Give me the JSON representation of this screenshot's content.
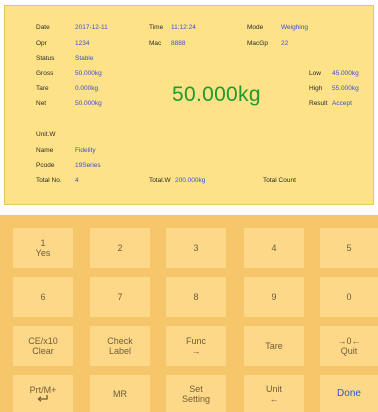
{
  "display": {
    "rows": {
      "date": {
        "label": "Date",
        "value": "2017-12-11"
      },
      "time": {
        "label": "Time",
        "value": "11:12:24"
      },
      "mode": {
        "label": "Mode",
        "value": "Weighing"
      },
      "opr": {
        "label": "Opr",
        "value": "1234"
      },
      "mac": {
        "label": "Mac",
        "value": "8888"
      },
      "macgp": {
        "label": "MacGp",
        "value": "22"
      },
      "status": {
        "label": "Status",
        "value": "Stable"
      },
      "gross": {
        "label": "Gross",
        "value": "50.000kg"
      },
      "tare": {
        "label": "Tare",
        "value": "0.000kg"
      },
      "net": {
        "label": "Net",
        "value": "50.000kg"
      },
      "low": {
        "label": "Low",
        "value": "45.000kg"
      },
      "high": {
        "label": "High",
        "value": "55.000kg"
      },
      "result": {
        "label": "Result",
        "value": "Accept"
      },
      "unitw": {
        "label": "Unit.W",
        "value": ""
      },
      "name": {
        "label": "Name",
        "value": "Fidelity"
      },
      "pcode": {
        "label": "Pcode",
        "value": "19Series"
      },
      "total_no": {
        "label": "Total No.",
        "value": "4"
      },
      "total_w": {
        "label": "Total.W",
        "value": "200.000kg"
      },
      "total_count": {
        "label": "Total Count",
        "value": ""
      }
    },
    "main_weight": "50.000kg"
  },
  "keypad": {
    "k1": {
      "l1": "1",
      "l2": "Yes"
    },
    "k2": {
      "l1": "2",
      "l2": ""
    },
    "k3": {
      "l1": "3",
      "l2": ""
    },
    "k4": {
      "l1": "4",
      "l2": ""
    },
    "k5": {
      "l1": "5",
      "l2": ""
    },
    "k6": {
      "l1": "6",
      "l2": ""
    },
    "k7": {
      "l1": "7",
      "l2": ""
    },
    "k8": {
      "l1": "8",
      "l2": ""
    },
    "k9": {
      "l1": "9",
      "l2": ""
    },
    "k0": {
      "l1": "0",
      "l2": ""
    },
    "ce": {
      "l1": "CE/x10",
      "l2": "Clear"
    },
    "check": {
      "l1": "Check",
      "l2": "Label"
    },
    "func": {
      "l1": "Func",
      "l2": "→"
    },
    "tare": {
      "l1": "Tare",
      "l2": ""
    },
    "quit": {
      "l1": "→0←",
      "l2": "Quit"
    },
    "prt": {
      "l1": "Prt/M+",
      "l2": "",
      "icon": "enter-arrow-icon"
    },
    "mr": {
      "l1": "MR",
      "l2": ""
    },
    "set": {
      "l1": "Set",
      "l2": "Setting"
    },
    "unit": {
      "l1": "Unit",
      "l2": "←"
    },
    "done": {
      "l1": "Done",
      "l2": ""
    }
  },
  "colors": {
    "display_bg": "#fde288",
    "value_blue": "#3b4fd8",
    "weight_green": "#1f9a2e",
    "keypad_bg": "#f5c66a",
    "key_bg": "#fdd888",
    "done_blue": "#2f56d8"
  }
}
